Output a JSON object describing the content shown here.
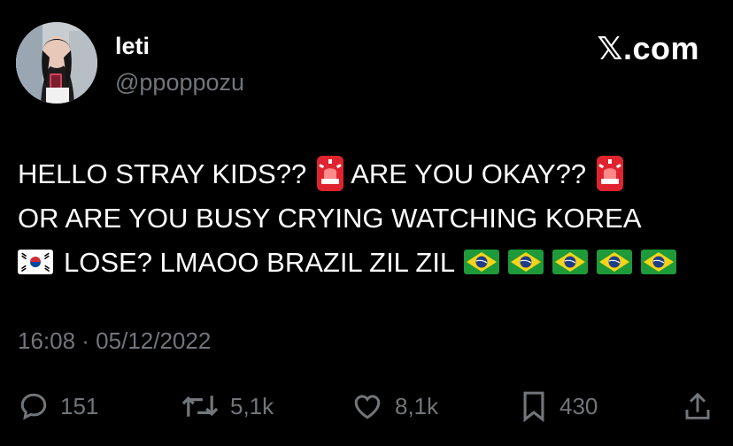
{
  "author": {
    "name": "leti",
    "handle": "@ppoppozu",
    "avatar_icon": "profile-photo-avatar"
  },
  "brand": {
    "logo": "𝕏",
    "suffix": ".com"
  },
  "tweet": {
    "line1_a": "HELLO STRAY KIDS??",
    "line1_b": "ARE YOU OKAY??",
    "line2": "OR ARE YOU BUSY CRYING WATCHING KOREA",
    "line3": "LOSE? LMAOO BRAZIL ZIL ZIL",
    "emoji": [
      "siren-emoji",
      "south-korea-flag-emoji",
      "brazil-flag-emoji"
    ]
  },
  "timestamp": "16:08 · 05/12/2022",
  "actions": {
    "replies": "151",
    "reposts": "5,1k",
    "likes": "8,1k",
    "bookmarks": "430"
  },
  "colors": {
    "background": "#000000",
    "text": "#ffffff",
    "muted": "#71767b"
  }
}
